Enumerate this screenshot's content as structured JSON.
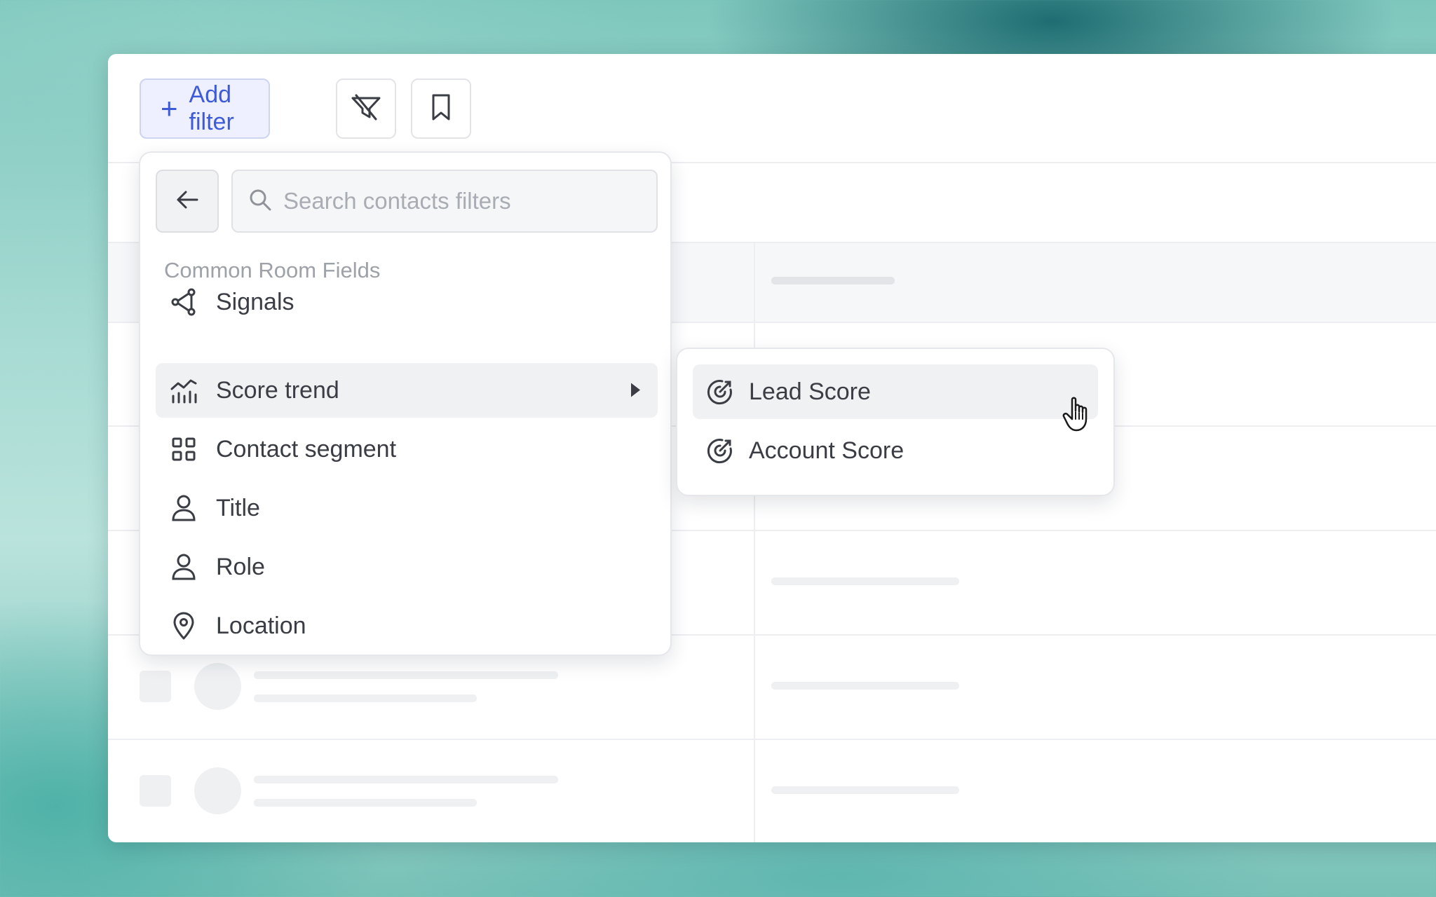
{
  "toolbar": {
    "add_filter_label": "Add filter",
    "add_filter_icon": "plus-icon",
    "clear_filter_icon": "filter-off-icon",
    "bookmark_icon": "bookmark-icon"
  },
  "dropdown": {
    "back_icon": "arrow-left-icon",
    "search": {
      "placeholder": "Search contacts filters",
      "value": ""
    },
    "section_label": "Common Room Fields",
    "items": [
      {
        "label": "Signals",
        "icon": "signals-icon"
      },
      {
        "label": "Score trend",
        "icon": "score-trend-icon",
        "active": true,
        "has_submenu": true
      },
      {
        "label": "Contact segment",
        "icon": "grid-icon"
      },
      {
        "label": "Title",
        "icon": "person-icon"
      },
      {
        "label": "Role",
        "icon": "person-icon"
      },
      {
        "label": "Location",
        "icon": "location-pin-icon"
      }
    ]
  },
  "submenu": {
    "items": [
      {
        "label": "Lead Score",
        "icon": "target-score-icon",
        "active": true
      },
      {
        "label": "Account Score",
        "icon": "target-score-icon"
      }
    ]
  },
  "colors": {
    "accent": "#3d5bd9",
    "accent_bg": "#eef0ff",
    "text": "#3a3d44",
    "muted": "#9da1a8",
    "hover_bg": "#f0f1f3"
  }
}
